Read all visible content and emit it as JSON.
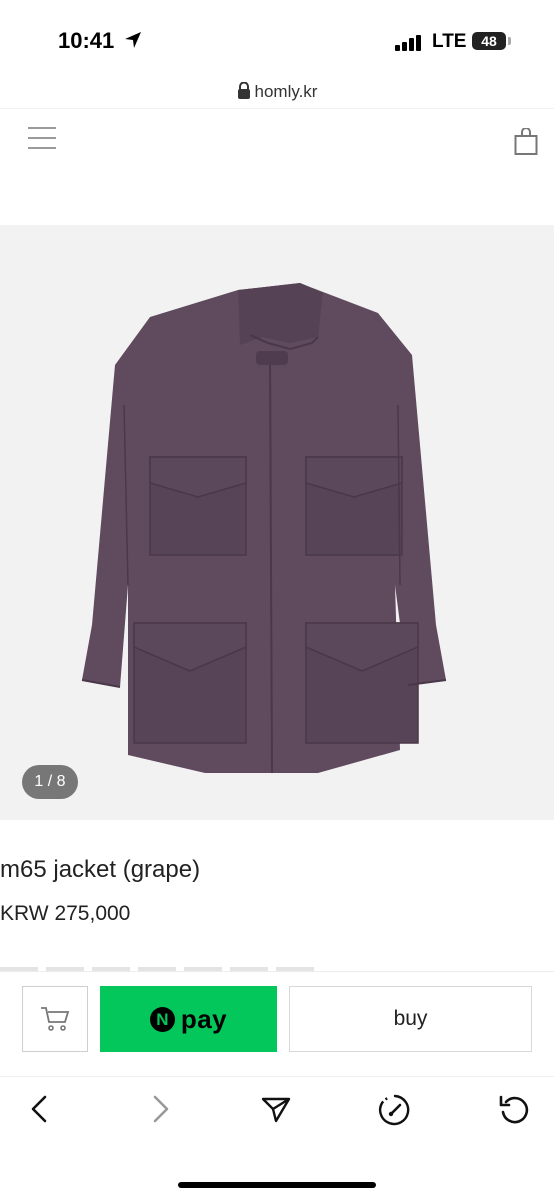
{
  "status_bar": {
    "time": "10:41",
    "network": "LTE",
    "battery": "48"
  },
  "browser": {
    "url": "homly.kr"
  },
  "header": {
    "menu_icon": "hamburger-menu-icon",
    "cart_icon": "shopping-bag-icon"
  },
  "gallery": {
    "counter": "1 / 8",
    "background": "#f2f2f2",
    "jacket_color": "#5f4a5e"
  },
  "product": {
    "title": "m65 jacket (grape)",
    "price": "KRW 275,000"
  },
  "actions": {
    "npay_n": "N",
    "npay_label": "pay",
    "npay_color": "#03c75a",
    "buy_label": "buy"
  },
  "toolbar": {
    "back_icon": "chevron-left-icon",
    "forward_icon": "chevron-right-icon",
    "share_icon": "send-icon",
    "speed_icon": "gauge-icon",
    "reload_icon": "reload-icon"
  }
}
